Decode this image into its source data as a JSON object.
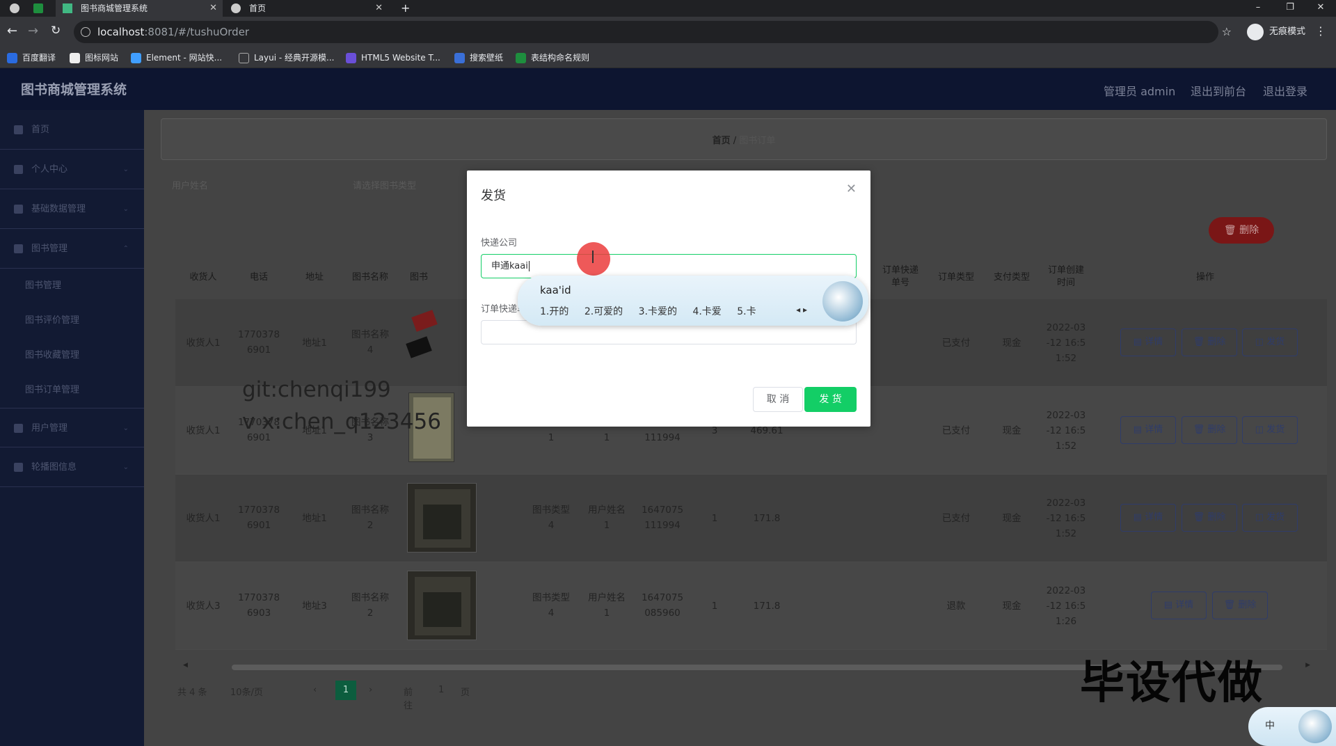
{
  "browser": {
    "tabs": [
      {
        "label": "图书商城管理系统",
        "active": true
      },
      {
        "label": "首页",
        "active": false
      }
    ],
    "url_host": "localhost",
    "url_path": ":8081/#/tushuOrder",
    "incognito_label": "无痕模式",
    "bookmarks": [
      "百度翻译",
      "图标网站",
      "Element - 网站快...",
      "Layui - 经典开源模...",
      "HTML5 Website T...",
      "搜索壁纸",
      "表结构命名规则"
    ]
  },
  "app": {
    "title": "图书商城管理系统",
    "header_links": [
      "管理员 admin",
      "退出到前台",
      "退出登录"
    ]
  },
  "sidebar": {
    "items": [
      "首页",
      "个人中心",
      "基础数据管理",
      "图书管理",
      "用户管理",
      "轮播图信息"
    ],
    "sub_items": [
      "图书管理",
      "图书评价管理",
      "图书收藏管理",
      "图书订单管理"
    ]
  },
  "breadcrumb": {
    "home": "首页",
    "sep": "/",
    "current": "图书订单"
  },
  "search": {
    "field1_placeholder": "用户姓名",
    "field2_placeholder": "请选择图书类型"
  },
  "delete_button": "删除",
  "table": {
    "headers": [
      "收货人",
      "电话",
      "地址",
      "图书名称",
      "图书",
      "订单快递单号",
      "订单类型",
      "支付类型",
      "订单创建时间",
      "操作"
    ],
    "rows": [
      {
        "name": "收货人1",
        "phone": "1770378\n6901",
        "addr": "地址1",
        "book": "图书名称\n4",
        "btype": "",
        "user": "",
        "orderno": "",
        "qty": "",
        "price": "",
        "status": "已支付",
        "pay": "现金",
        "time": "2022-03\n-12 16:5\n1:52",
        "ops": [
          "详情",
          "删除",
          "发货"
        ]
      },
      {
        "name": "收货人1",
        "phone": "1770378\n6901",
        "addr": "地址1",
        "book": "图书名称\n3",
        "btype": "图书类型\n1",
        "user": "用户姓名\n1",
        "orderno": "1647075\n111994",
        "qty": "3",
        "price": "469.61",
        "status": "已支付",
        "pay": "现金",
        "time": "2022-03\n-12 16:5\n1:52",
        "ops": [
          "详情",
          "删除",
          "发货"
        ]
      },
      {
        "name": "收货人1",
        "phone": "1770378\n6901",
        "addr": "地址1",
        "book": "图书名称\n2",
        "btype": "图书类型\n4",
        "user": "用户姓名\n1",
        "orderno": "1647075\n111994",
        "qty": "1",
        "price": "171.8",
        "status": "已支付",
        "pay": "现金",
        "time": "2022-03\n-12 16:5\n1:52",
        "ops": [
          "详情",
          "删除",
          "发货"
        ]
      },
      {
        "name": "收货人3",
        "phone": "1770378\n6903",
        "addr": "地址3",
        "book": "图书名称\n2",
        "btype": "图书类型\n4",
        "user": "用户姓名\n1",
        "orderno": "1647075\n085960",
        "qty": "1",
        "price": "171.8",
        "status": "退款",
        "pay": "现金",
        "time": "2022-03\n-12 16:5\n1:26",
        "ops": [
          "详情",
          "删除"
        ]
      }
    ]
  },
  "pagination": {
    "total": "共 4 条",
    "page_size": "10条/页",
    "current": "1",
    "goto_label": "前往",
    "goto_value": "1",
    "page_suffix": "页"
  },
  "dialog": {
    "title": "发货",
    "company_label": "快递公司",
    "company_value": "申通kaai",
    "tracking_label": "订单快递单号",
    "tracking_value": "",
    "cancel": "取 消",
    "confirm": "发 货"
  },
  "ime": {
    "composition": "kaa'id",
    "candidates": [
      "1.开的",
      "2.可爱的",
      "3.卡爱的",
      "4.卡爱",
      "5.卡"
    ],
    "dock_label": "中"
  },
  "watermarks": {
    "line1": "git:chenqi199",
    "line2": "v x:chen_q123456",
    "big": "毕设代做"
  }
}
